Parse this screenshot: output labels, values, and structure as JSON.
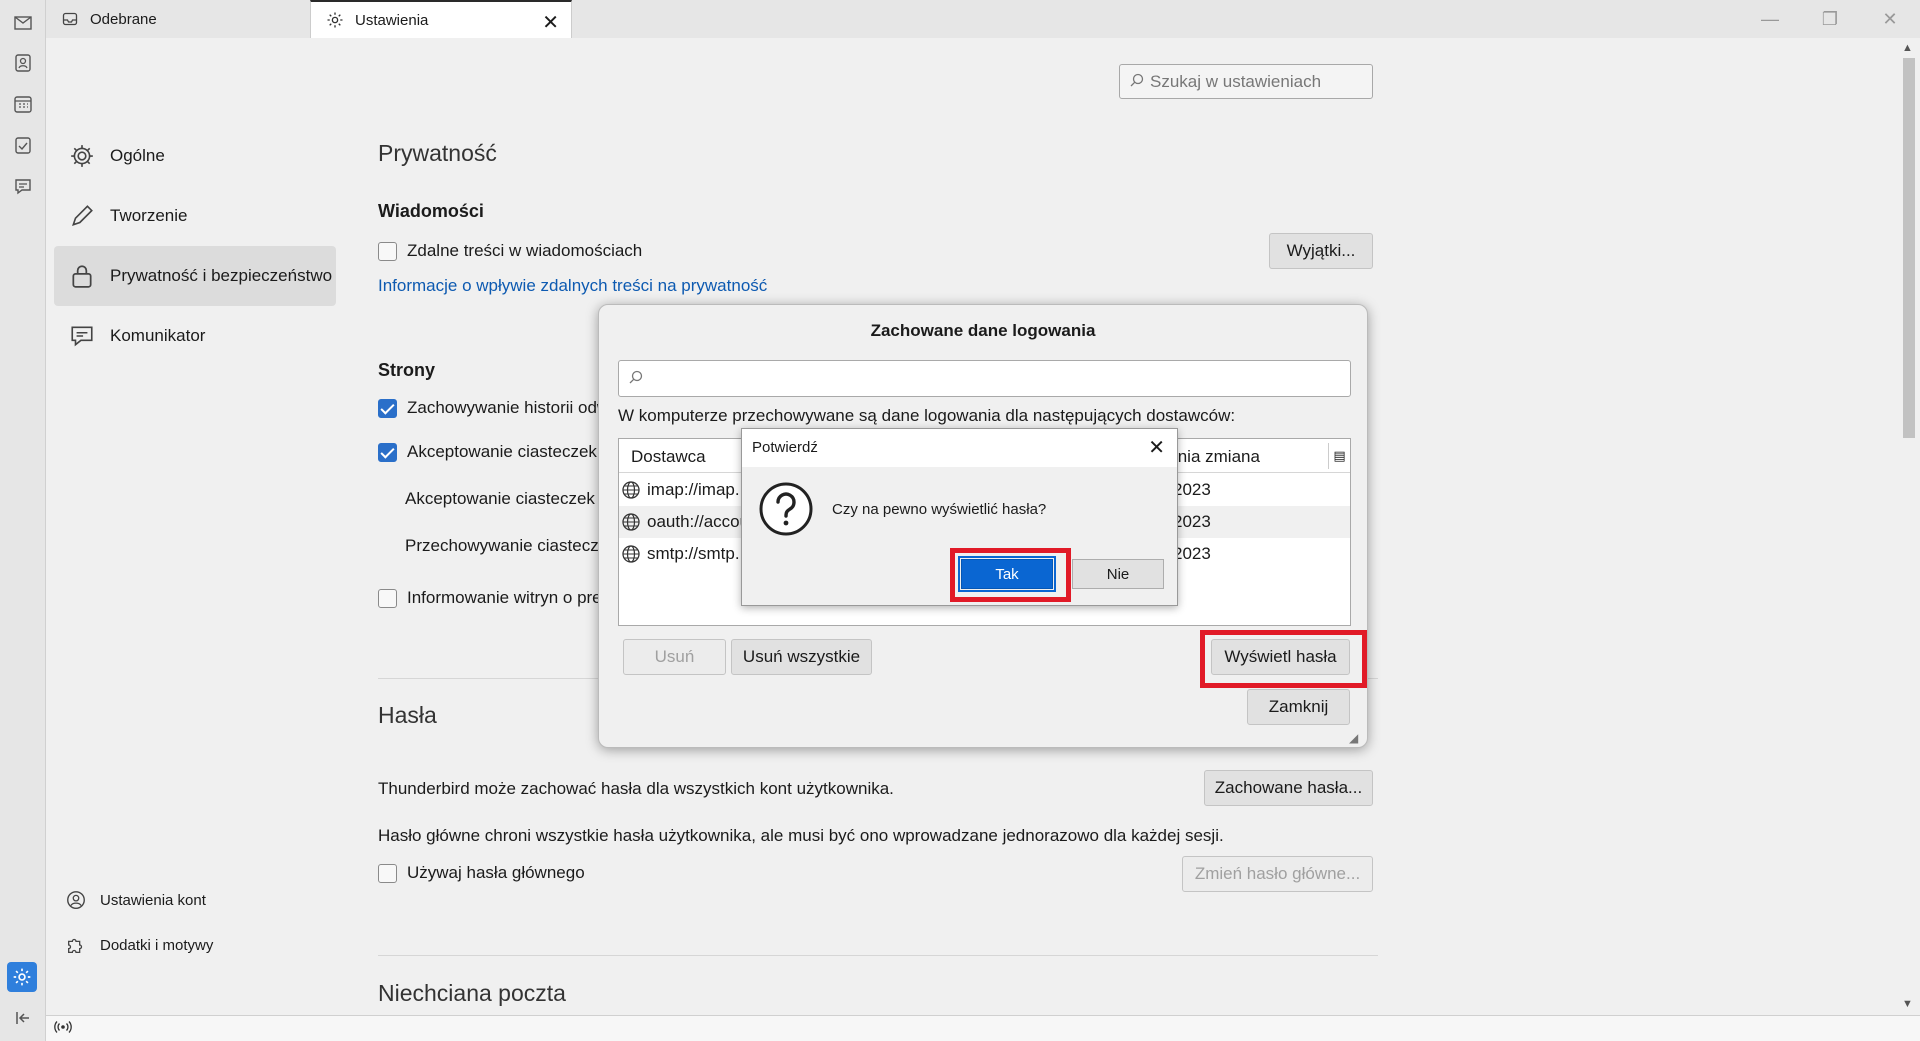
{
  "tabs": [
    {
      "label": "Odebrane",
      "icon": "inbox-icon"
    },
    {
      "label": "Ustawienia",
      "icon": "gear-icon"
    }
  ],
  "nav": {
    "items": [
      {
        "label": "Ogólne",
        "icon": "gear-icon"
      },
      {
        "label": "Tworzenie",
        "icon": "pencil-icon"
      },
      {
        "label": "Prywatność i bezpieczeństwo",
        "icon": "lock-icon"
      },
      {
        "label": "Komunikator",
        "icon": "chat-icon"
      }
    ],
    "bottom": [
      {
        "label": "Ustawienia kont",
        "icon": "account-settings-icon"
      },
      {
        "label": "Dodatki i motywy",
        "icon": "puzzle-icon"
      }
    ]
  },
  "search": {
    "placeholder": "Szukaj w ustawieniach"
  },
  "privacy": {
    "title": "Prywatność",
    "messages_heading": "Wiadomości",
    "remote_content": {
      "label": "Zdalne treści w wiadomościach",
      "checked": false
    },
    "exceptions_button": "Wyjątki...",
    "info_link": "Informacje o wpływie zdalnych treści na prywatność",
    "sites_heading": "Strony",
    "history": {
      "label": "Zachowywanie historii odw",
      "checked": true
    },
    "cookies": {
      "label": "Akceptowanie ciasteczek",
      "checked": true
    },
    "cookies_third": "Akceptowanie ciasteczek z",
    "cookies_keep": "Przechowywanie ciasteczek",
    "dnt": {
      "label": "Informowanie witryn o pre",
      "checked": false
    }
  },
  "passwords": {
    "title": "Hasła",
    "desc1": "Thunderbird może zachować hasła dla wszystkich kont użytkownika.",
    "saved_button": "Zachowane hasła...",
    "desc2": "Hasło główne chroni wszystkie hasła użytkownika, ale musi być ono wprowadzane jednorazowo dla każdej sesji.",
    "use_master": {
      "label": "Używaj hasła głównego",
      "checked": false
    },
    "change_master_button": "Zmień hasło główne..."
  },
  "junk": {
    "title": "Niechciana poczta"
  },
  "logins_dialog": {
    "title": "Zachowane dane logowania",
    "description": "W komputerze przechowywane są dane logowania dla następujących dostawców:",
    "columns": [
      "Dostawca",
      "tnia zmiana"
    ],
    "rows": [
      {
        "provider": "imap://imap.",
        "changed": "2023"
      },
      {
        "provider": "oauth://accou",
        "changed": "2023"
      },
      {
        "provider": "smtp://smtp.",
        "changed": "2023"
      }
    ],
    "remove_button": "Usuń",
    "remove_all_button": "Usuń wszystkie",
    "show_passwords_button": "Wyświetl hasła",
    "close_button": "Zamknij"
  },
  "confirm_dialog": {
    "title": "Potwierdź",
    "message": "Czy na pewno wyświetlić hasła?",
    "yes": "Tak",
    "no": "Nie"
  },
  "colors": {
    "accent": "#0a66d2",
    "highlight": "#e11a27",
    "link": "#0d5ab1"
  }
}
